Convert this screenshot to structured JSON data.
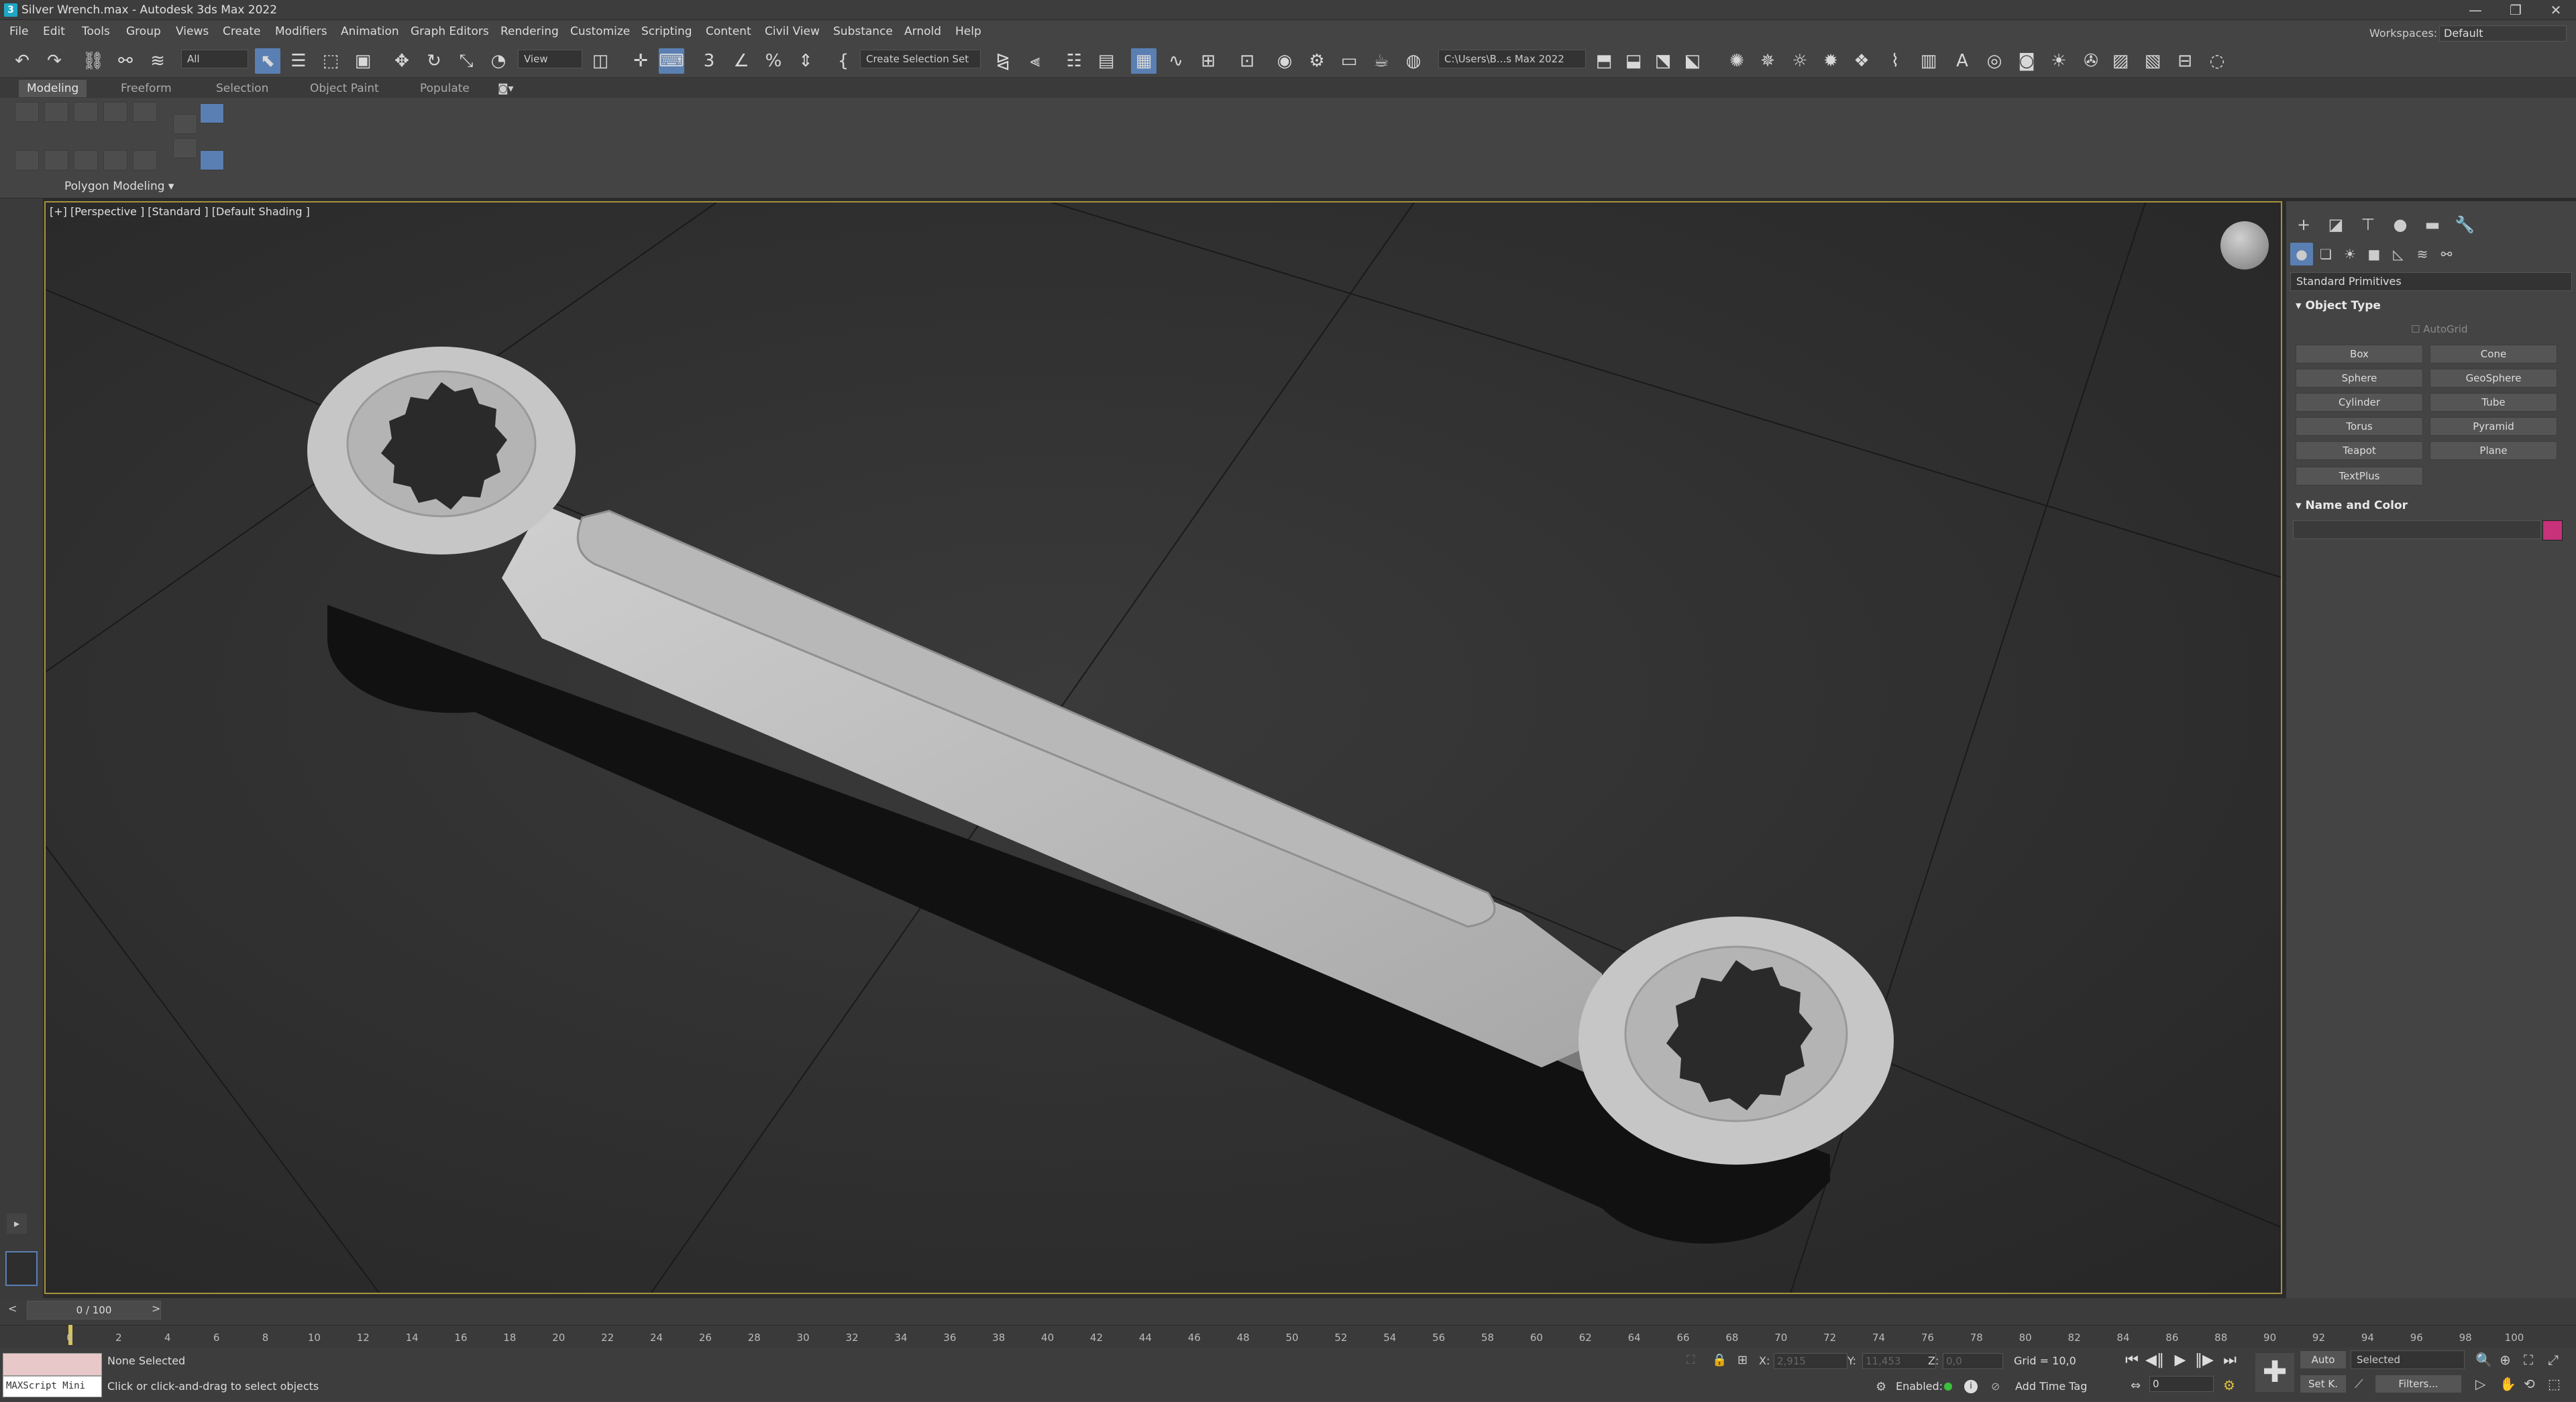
{
  "window": {
    "app_icon": "3",
    "title": "Silver Wrench.max - Autodesk 3ds Max 2022",
    "minimize": "—",
    "maximize": "❐",
    "close": "✕"
  },
  "menu": [
    "File",
    "Edit",
    "Tools",
    "Group",
    "Views",
    "Create",
    "Modifiers",
    "Animation",
    "Graph Editors",
    "Rendering",
    "Customize",
    "Scripting",
    "Content",
    "Civil View",
    "Substance",
    "Arnold",
    "Help"
  ],
  "workspaces": {
    "label": "Workspaces:",
    "value": "Default"
  },
  "toolbar": {
    "filter_value": "All",
    "ref_coord_value": "View",
    "selection_set_value": "Create Selection Set",
    "project_path": "C:\\Users\\B...s Max 2022"
  },
  "ribbon": {
    "tabs": [
      "Modeling",
      "Freeform",
      "Selection",
      "Object Paint",
      "Populate"
    ],
    "active_tab": "Modeling",
    "panel_label": "Polygon Modeling ▾"
  },
  "viewport": {
    "label": "[+] [Perspective ] [Standard ] [Default Shading ]"
  },
  "command_panel": {
    "dropdown": "Standard Primitives",
    "object_type_title": "Object Type",
    "autogrid": "AutoGrid",
    "primitives": [
      "Box",
      "Cone",
      "Sphere",
      "GeoSphere",
      "Cylinder",
      "Tube",
      "Torus",
      "Pyramid",
      "Teapot",
      "Plane",
      "TextPlus"
    ],
    "name_color_title": "Name and Color",
    "swatch_color": "#c8327a"
  },
  "timeline": {
    "slider": "0 / 100",
    "prev": "<",
    "next": ">",
    "ticks": [
      "0",
      "2",
      "4",
      "6",
      "8",
      "10",
      "12",
      "14",
      "16",
      "18",
      "20",
      "22",
      "24",
      "26",
      "28",
      "30",
      "32",
      "34",
      "36",
      "38",
      "40",
      "42",
      "44",
      "46",
      "48",
      "50",
      "52",
      "54",
      "56",
      "58",
      "60",
      "62",
      "64",
      "66",
      "68",
      "70",
      "72",
      "74",
      "76",
      "78",
      "80",
      "82",
      "84",
      "86",
      "88",
      "90",
      "92",
      "94",
      "96",
      "98",
      "100"
    ]
  },
  "status": {
    "maxscript": "MAXScript Mini",
    "selection": "None Selected",
    "prompt": "Click or click-and-drag to select objects",
    "x_label": "X:",
    "x_value": "2,915",
    "y_label": "Y:",
    "y_value": "11,453",
    "z_label": "Z:",
    "z_value": "0,0",
    "grid": "Grid = 10,0",
    "enabled_label": "Enabled:",
    "add_time_tag": "Add Time Tag",
    "auto_label": "Auto",
    "selected_value": "Selected",
    "frame_value": "0",
    "setk_label": "Set K.",
    "filters_label": "Filters..."
  }
}
